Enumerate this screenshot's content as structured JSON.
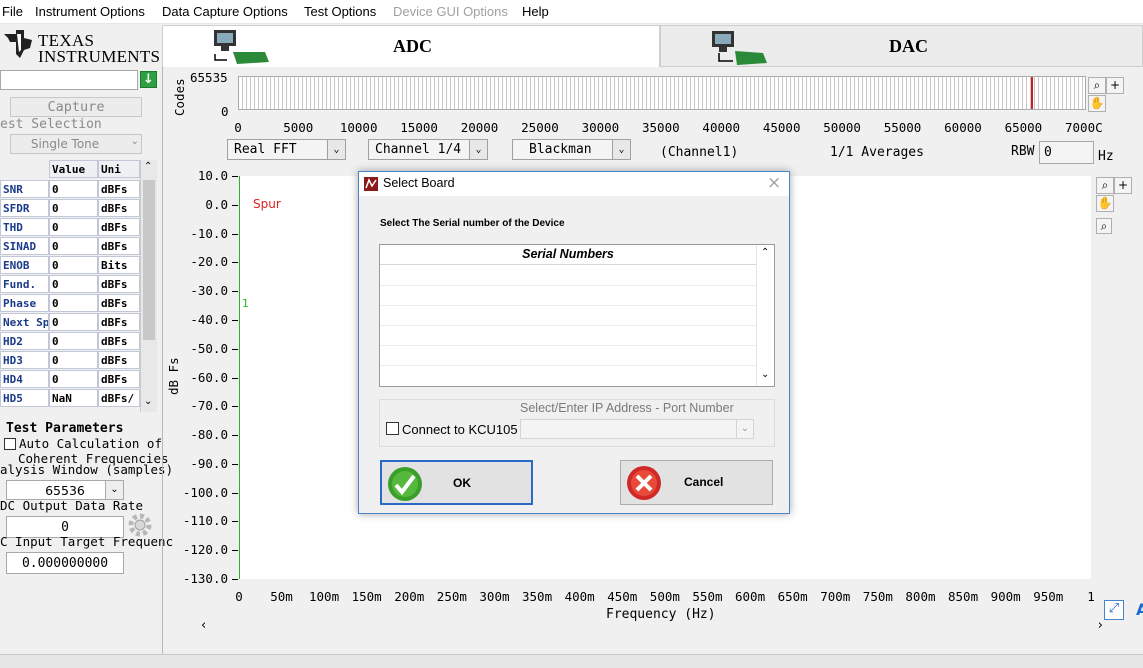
{
  "menu": {
    "items": [
      "File",
      "Instrument Options",
      "Data Capture Options",
      "Test Options",
      "Device GUI Options",
      "Help"
    ]
  },
  "logo": {
    "line1": "TEXAS",
    "line2": "INSTRUMENTS"
  },
  "tabs": {
    "adc": "ADC",
    "dac": "DAC",
    "active": "ADC"
  },
  "left_panel": {
    "capture_label": "Capture",
    "test_selection_label": "est Selection",
    "test_selection_value": "Single Tone",
    "metrics_headers": [
      "Value",
      "Uni"
    ],
    "metrics": [
      {
        "name": "SNR",
        "value": "0",
        "unit": "dBFs"
      },
      {
        "name": "SFDR",
        "value": "0",
        "unit": "dBFs"
      },
      {
        "name": "THD",
        "value": "0",
        "unit": "dBFs"
      },
      {
        "name": "SINAD",
        "value": "0",
        "unit": "dBFs"
      },
      {
        "name": "ENOB",
        "value": "0",
        "unit": "Bits"
      },
      {
        "name": "Fund.",
        "value": "0",
        "unit": "dBFs"
      },
      {
        "name": "Phase",
        "value": "0",
        "unit": "dBFs"
      },
      {
        "name": "Next Sp",
        "value": "0",
        "unit": "dBFs"
      },
      {
        "name": "HD2",
        "value": "0",
        "unit": "dBFs"
      },
      {
        "name": "HD3",
        "value": "0",
        "unit": "dBFs"
      },
      {
        "name": "HD4",
        "value": "0",
        "unit": "dBFs"
      },
      {
        "name": "HD5",
        "value": "NaN",
        "unit": "dBFs/"
      }
    ],
    "test_parameters_title": "Test Parameters",
    "auto_calc_line1": "Auto Calculation of",
    "auto_calc_line2": "Coherent Frequencies",
    "analysis_window_label": "alysis Window (samples)",
    "analysis_window_value": "65536",
    "output_rate_label": "DC Output Data Rate",
    "output_rate_value": "0",
    "target_freq_label": "C Input Target Frequenc",
    "target_freq_value": "0.000000000"
  },
  "code_plot": {
    "ylabel": "Codes",
    "y_ticks": [
      "65535",
      "0"
    ],
    "x_ticks": [
      "0",
      "5000",
      "10000",
      "15000",
      "20000",
      "25000",
      "30000",
      "35000",
      "40000",
      "45000",
      "50000",
      "55000",
      "60000",
      "65000",
      "7000C"
    ]
  },
  "controls": {
    "fft_type": "Real FFT",
    "channel": "Channel 1/4",
    "window": "Blackman",
    "channel_text": "(Channel1)",
    "averages": "1/1 Averages",
    "rbw_label": "RBW",
    "rbw_value": "0",
    "rbw_unit": "Hz"
  },
  "chart_data": {
    "type": "line",
    "title": "",
    "xlabel": "Frequency (Hz)",
    "ylabel": "dB Fs",
    "x_ticks": [
      "0",
      "50m",
      "100m",
      "150m",
      "200m",
      "250m",
      "300m",
      "350m",
      "400m",
      "450m",
      "500m",
      "550m",
      "600m",
      "650m",
      "700m",
      "750m",
      "800m",
      "850m",
      "900m",
      "950m",
      "1"
    ],
    "y_ticks": [
      "10.0",
      "0.0",
      "-10.0",
      "-20.0",
      "-30.0",
      "-40.0",
      "-50.0",
      "-60.0",
      "-70.0",
      "-80.0",
      "-90.0",
      "-100.0",
      "-110.0",
      "-120.0",
      "-130.0"
    ],
    "ylim": [
      -130,
      10
    ],
    "xlim": [
      0,
      1
    ],
    "grid": false,
    "annotations": [
      "Spur",
      "1"
    ],
    "series": []
  },
  "dialog": {
    "title": "Select Board",
    "close": "×",
    "prompt": "Select The Serial number of the Device",
    "list_header": "Serial Numbers",
    "ip_label": "Select/Enter IP Address - Port Number",
    "connect_label": "Connect to KCU105",
    "ok_label": "OK",
    "cancel_label": "Cancel"
  },
  "colors": {
    "accent": "#4a84c8",
    "plot_green": "#28b428",
    "spur_red": "#e02020",
    "ok_green": "#3a9e2a",
    "cancel_red": "#e0302a"
  }
}
